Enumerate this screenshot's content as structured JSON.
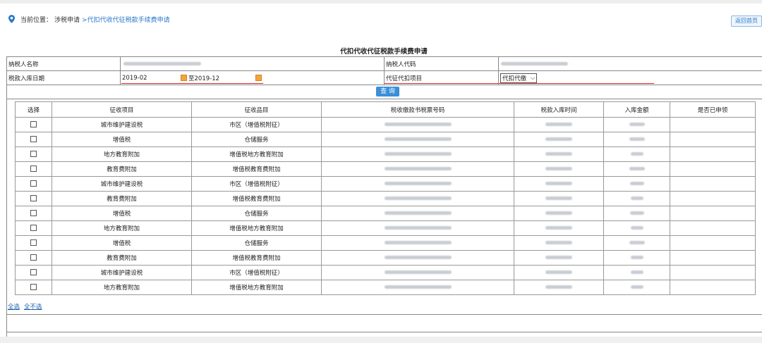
{
  "breadcrumb": {
    "prefix": "当前位置：",
    "level1": "涉税申请",
    "level2": ">代扣代收代征税款手续费申请"
  },
  "home_button": "返回首页",
  "title": "代扣代收代征税款手续费申请",
  "form": {
    "taxpayer_name_label": "纳税人名称",
    "taxpayer_code_label": "纳税人代码",
    "date_label": "税款入库日期",
    "date_from": "2019-02",
    "date_to": "至2019-12",
    "project_label": "代征代扣项目",
    "project_value": "代扣代缴",
    "query_button": "查 询"
  },
  "table": {
    "headers": [
      "选择",
      "征收项目",
      "征收品目",
      "税收缴款书税票号码",
      "税款入库时间",
      "入库金额",
      "是否已申领"
    ],
    "rows": [
      {
        "item": "城市维护建设税",
        "subitem": "市区（增值税附征）"
      },
      {
        "item": "增值税",
        "subitem": "仓储服务"
      },
      {
        "item": "地方教育附加",
        "subitem": "增值税地方教育附加"
      },
      {
        "item": "教育费附加",
        "subitem": "增值税教育费附加"
      },
      {
        "item": "城市维护建设税",
        "subitem": "市区（增值税附征）"
      },
      {
        "item": "教育费附加",
        "subitem": "增值税教育费附加"
      },
      {
        "item": "增值税",
        "subitem": "仓储服务"
      },
      {
        "item": "地方教育附加",
        "subitem": "增值税地方教育附加"
      },
      {
        "item": "增值税",
        "subitem": "仓储服务"
      },
      {
        "item": "教育费附加",
        "subitem": "增值税教育费附加"
      },
      {
        "item": "城市维护建设税",
        "subitem": "市区（增值税附征）"
      },
      {
        "item": "地方教育附加",
        "subitem": "增值税地方教育附加"
      }
    ]
  },
  "select_all": "全选",
  "select_none": "全不选",
  "colors": {
    "accent": "#2a78c8",
    "query_button": "#3a8fd8",
    "underline": "#dd2222",
    "calendar": "#f2a63a"
  }
}
